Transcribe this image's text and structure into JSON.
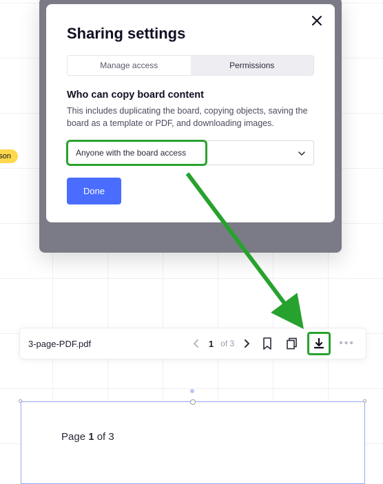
{
  "tag_chip": "hnson",
  "modal": {
    "title": "Sharing settings",
    "tabs": {
      "manage": "Manage access",
      "permissions": "Permissions"
    },
    "section_heading": "Who can copy board content",
    "section_desc": "This includes duplicating the board, copying objects, saving the board as a template or PDF, and downloading images.",
    "select_value": "Anyone with the board access",
    "done_label": "Done"
  },
  "toolbar": {
    "filename": "3-page-PDF.pdf",
    "page_current": "1",
    "page_of_prefix": "of ",
    "page_total": "3"
  },
  "doc": {
    "page_prefix": "Page ",
    "page_num": "1",
    "page_suffix": " of 3"
  }
}
